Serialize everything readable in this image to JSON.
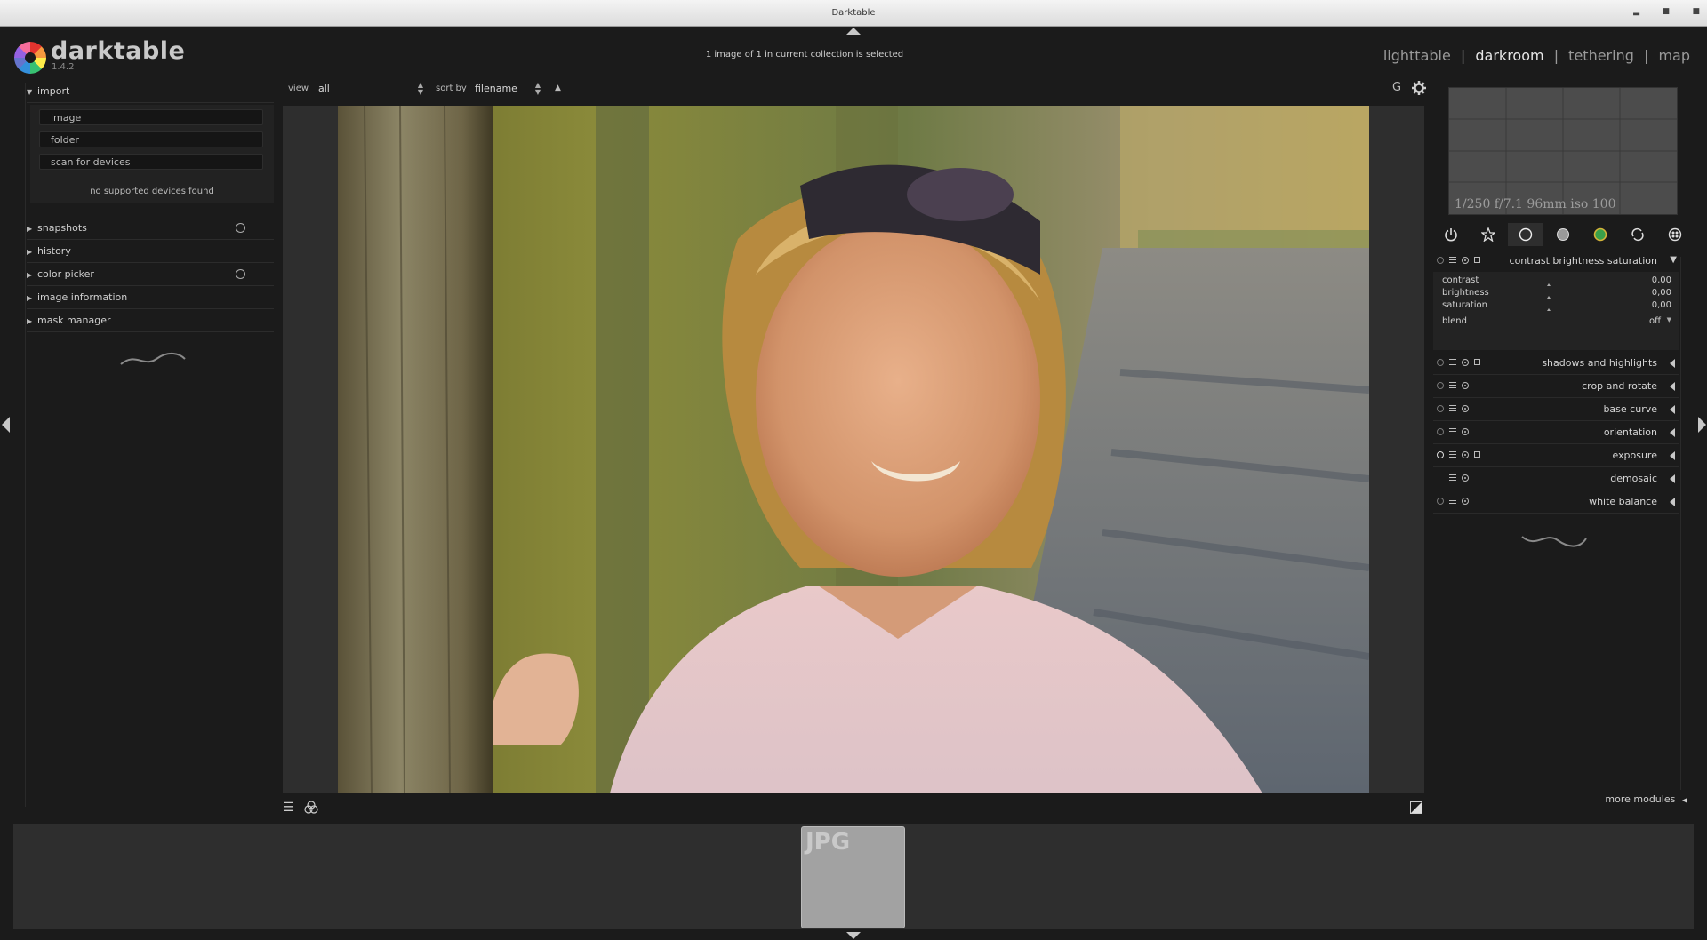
{
  "window": {
    "title": "Darktable"
  },
  "app": {
    "name": "darktable",
    "version": "1.4.2"
  },
  "header": {
    "status": "1 image of 1 in current collection is selected",
    "views": [
      {
        "label": "lighttable",
        "active": false
      },
      {
        "label": "darkroom",
        "active": true
      },
      {
        "label": "tethering",
        "active": false
      },
      {
        "label": "map",
        "active": false
      }
    ],
    "separator": "|"
  },
  "left_panel": {
    "import": {
      "label": "import",
      "buttons": [
        "image",
        "folder",
        "scan for devices"
      ],
      "status": "no supported devices found"
    },
    "modules": [
      {
        "label": "snapshots",
        "has_icon": true
      },
      {
        "label": "history",
        "has_icon": false
      },
      {
        "label": "color picker",
        "has_icon": true
      },
      {
        "label": "image information",
        "has_icon": false
      },
      {
        "label": "mask manager",
        "has_icon": false
      }
    ]
  },
  "toolbar": {
    "view_label": "view",
    "view_value": "all",
    "sort_label": "sort by",
    "sort_value": "filename",
    "sort_dir": "▲",
    "grouping_label": "G"
  },
  "histogram": {
    "info": "1/250 f/7.1 96mm iso 100"
  },
  "right_panel": {
    "expanded_module": {
      "title": "contrast brightness saturation",
      "sliders": [
        {
          "label": "contrast",
          "value": "0,00"
        },
        {
          "label": "brightness",
          "value": "0,00"
        },
        {
          "label": "saturation",
          "value": "0,00"
        }
      ],
      "blend_label": "blend",
      "blend_value": "off"
    },
    "modules": [
      {
        "title": "shadows and highlights",
        "enabled": false,
        "presets": true
      },
      {
        "title": "crop and rotate",
        "enabled": false,
        "presets": false
      },
      {
        "title": "base curve",
        "enabled": false,
        "presets": false
      },
      {
        "title": "orientation",
        "enabled": false,
        "presets": false
      },
      {
        "title": "exposure",
        "enabled": true,
        "presets": true
      },
      {
        "title": "demosaic",
        "enabled": null,
        "presets": false
      },
      {
        "title": "white balance",
        "enabled": false,
        "presets": false
      }
    ],
    "more_modules": "more modules"
  },
  "filmstrip": {
    "thumb_label": "JPG"
  },
  "icons": [
    "power-icon",
    "star-icon",
    "circle-icon",
    "tone-icon",
    "color-icon",
    "correct-icon",
    "effect-icon"
  ]
}
